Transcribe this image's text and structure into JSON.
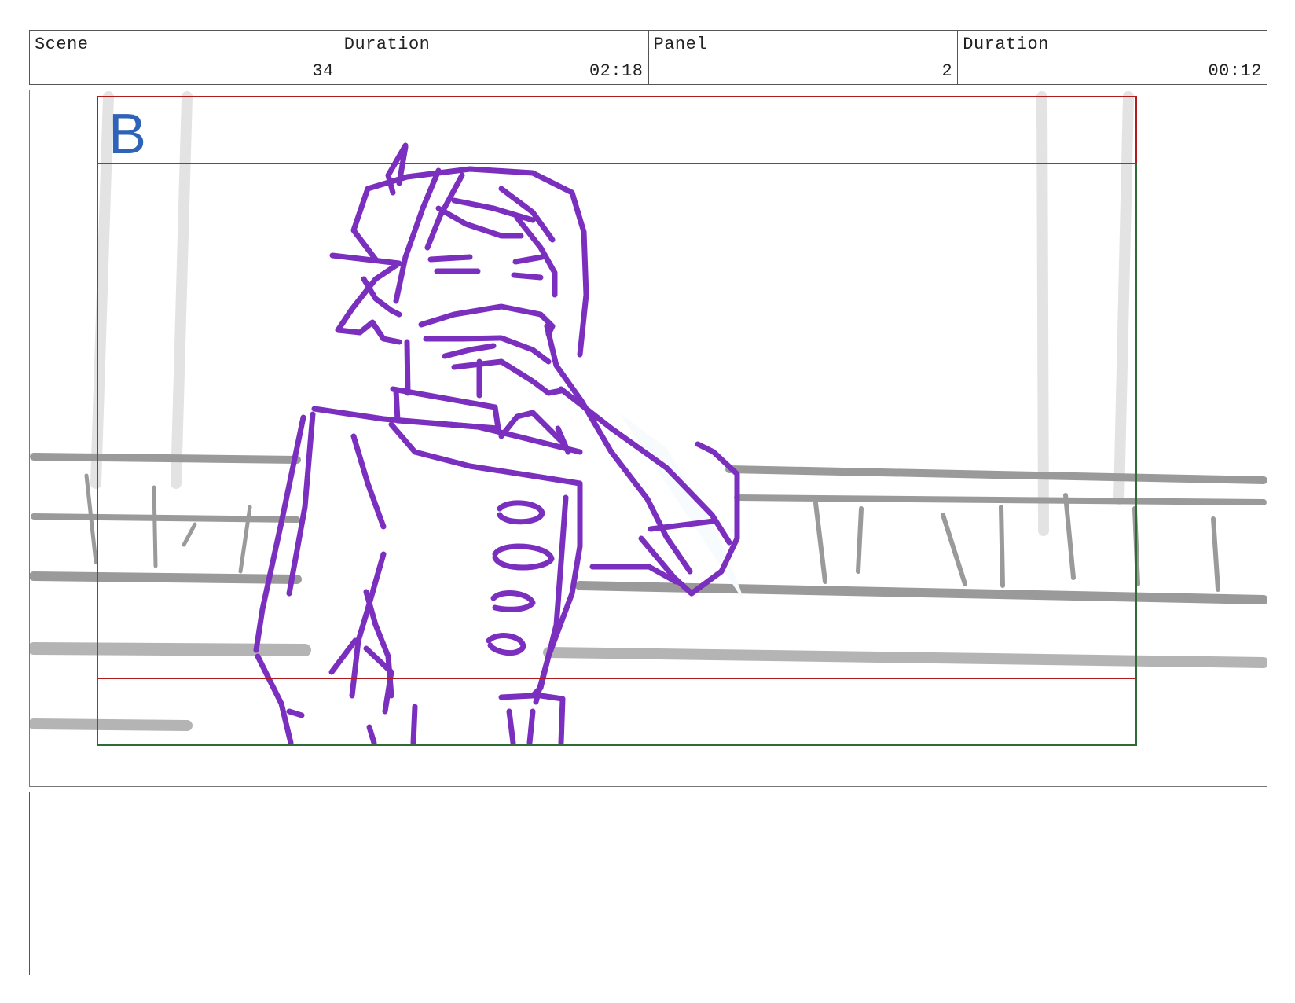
{
  "header": {
    "scene_label": "Scene",
    "scene_value": "34",
    "scene_duration_label": "Duration",
    "scene_duration_value": "02:18",
    "panel_label": "Panel",
    "panel_value": "2",
    "panel_duration_label": "Duration",
    "panel_duration_value": "00:12"
  },
  "panel": {
    "layer_letter": "B",
    "colors": {
      "sketch": "#7B2FBE",
      "background_lines": "#9a9a9a",
      "action_safe": "#b01c1c",
      "title_safe": "#2f6b35",
      "layer_letter": "#2e63b8"
    }
  },
  "notes": {
    "text": ""
  }
}
